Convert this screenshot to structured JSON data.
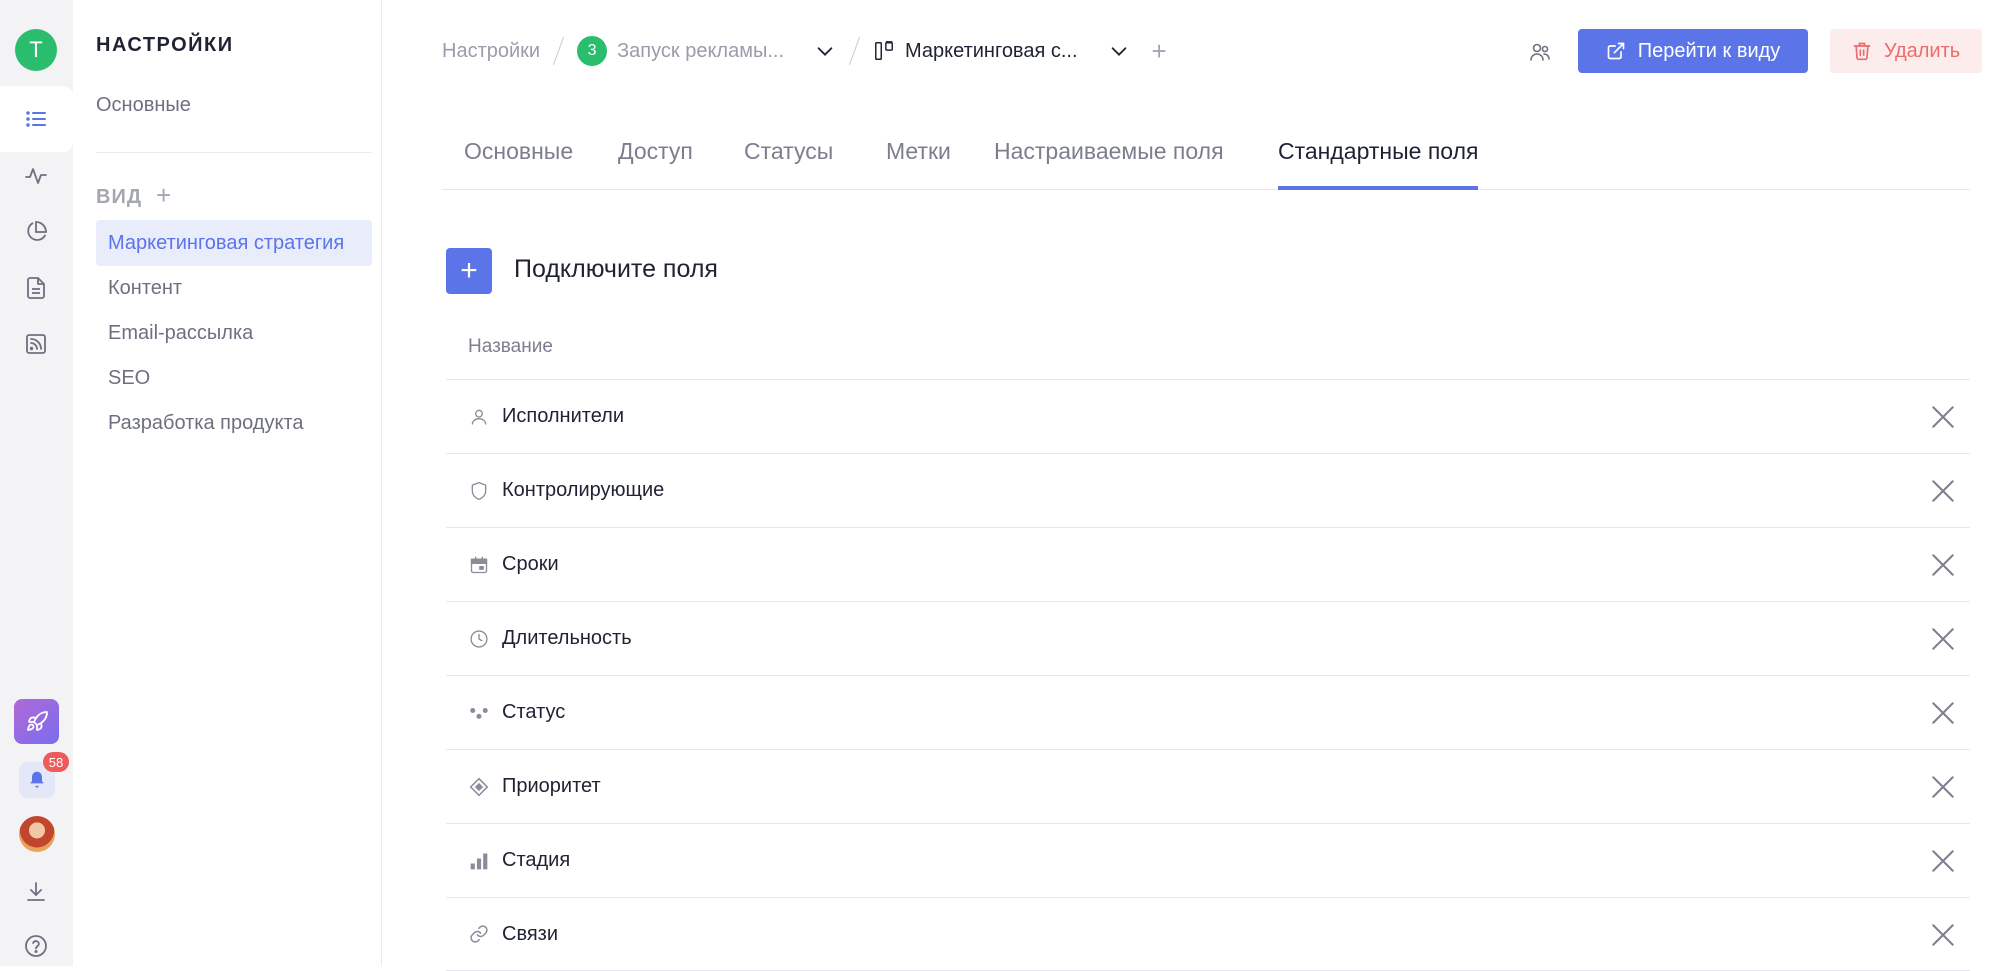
{
  "rail": {
    "avatar_letter": "Т",
    "notifications_count": "58",
    "icons": [
      "list-icon",
      "activity-icon",
      "pie-chart-icon",
      "document-icon",
      "rss-icon",
      "rocket-icon",
      "bell-icon",
      "download-icon",
      "help-icon"
    ]
  },
  "settings": {
    "title": "НАСТРОЙКИ",
    "main_item": "Основные",
    "views_title": "ВИД",
    "views": [
      {
        "label": "Маркетинговая стратегия",
        "active": true
      },
      {
        "label": "Контент",
        "active": false
      },
      {
        "label": "Email-рассылка",
        "active": false
      },
      {
        "label": "SEO",
        "active": false
      },
      {
        "label": "Разработка продукта",
        "active": false
      }
    ]
  },
  "breadcrumb": {
    "root": "Настройки",
    "project_number": "3",
    "project": "Запуск рекламы...",
    "view": "Маркетинговая с..."
  },
  "actions": {
    "go_to_view": "Перейти к виду",
    "delete": "Удалить"
  },
  "tabs": [
    {
      "label": "Основные",
      "active": false
    },
    {
      "label": "Доступ",
      "active": false
    },
    {
      "label": "Статусы",
      "active": false
    },
    {
      "label": "Метки",
      "active": false
    },
    {
      "label": "Настраиваемые поля",
      "active": false
    },
    {
      "label": "Стандартные поля",
      "active": true
    }
  ],
  "fields_section": {
    "add_label": "Подключите поля",
    "column_name": "Название",
    "rows": [
      {
        "label": "Исполнители",
        "icon": "person-icon"
      },
      {
        "label": "Контролирующие",
        "icon": "shield-icon"
      },
      {
        "label": "Сроки",
        "icon": "calendar-icon"
      },
      {
        "label": "Длительность",
        "icon": "clock-icon"
      },
      {
        "label": "Статус",
        "icon": "status-dots-icon"
      },
      {
        "label": "Приоритет",
        "icon": "priority-diamond-icon"
      },
      {
        "label": "Стадия",
        "icon": "bars-icon"
      },
      {
        "label": "Связи",
        "icon": "link-icon"
      }
    ]
  },
  "colors": {
    "accent": "#5b74e8",
    "danger": "#ee6b6b",
    "success": "#2bbd6e"
  }
}
